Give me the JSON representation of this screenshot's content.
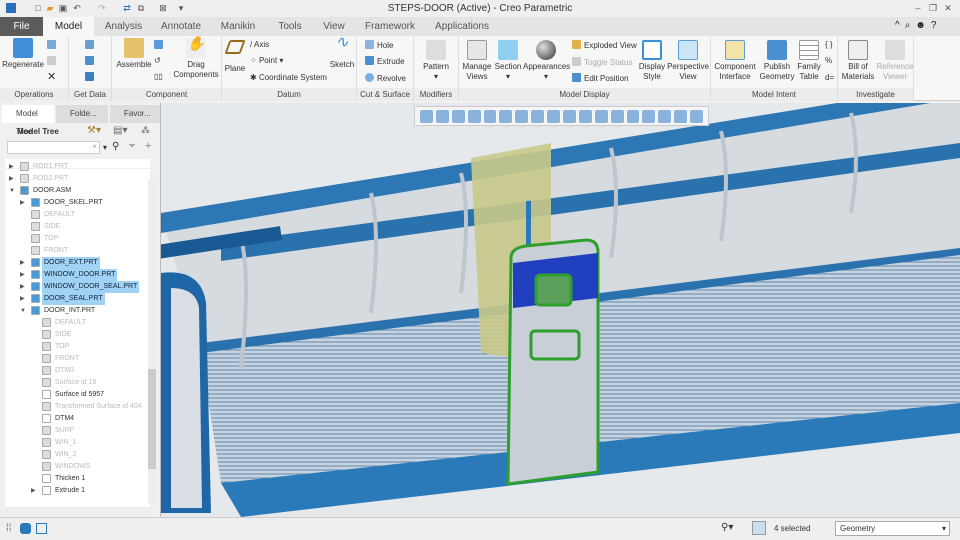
{
  "window": {
    "title": "STEPS-DOOR (Active) - Creo Parametric"
  },
  "tabs": [
    "File",
    "Model",
    "Analysis",
    "Annotate",
    "Manikin",
    "Tools",
    "View",
    "Framework",
    "Applications"
  ],
  "ribbon": {
    "operations": {
      "label": "Operations",
      "regenerate": "Regenerate"
    },
    "get_data": {
      "label": "Get Data"
    },
    "component": {
      "label": "Component",
      "assemble": "Assemble",
      "drag": "Drag Components"
    },
    "datum": {
      "label": "Datum",
      "plane": "Plane",
      "axis": "Axis",
      "point": "Point",
      "csys": "Coordinate System",
      "sketch": "Sketch"
    },
    "cut_surface": {
      "label": "Cut & Surface",
      "hole": "Hole",
      "extrude": "Extrude",
      "revolve": "Revolve"
    },
    "modifiers": {
      "label": "Modifiers",
      "pattern": "Pattern"
    },
    "model_display": {
      "label": "Model Display",
      "manage_views": "Manage Views",
      "section": "Section",
      "appearances": "Appearances",
      "exploded": "Exploded View",
      "toggle": "Toggle Status",
      "edit_position": "Edit Position",
      "display_style": "Display Style",
      "perspective": "Perspective View"
    },
    "model_intent": {
      "label": "Model Intent",
      "component_interface": "Component Interface",
      "publish": "Publish Geometry",
      "family": "Family Table"
    },
    "investigate": {
      "label": "Investigate",
      "bom": "Bill of Materials",
      "reference_viewer": "Reference Viewer"
    }
  },
  "panel": {
    "tabs": [
      "Model Tree",
      "Folde...",
      "Favor..."
    ],
    "title": "Model Tree"
  },
  "tree": [
    {
      "label": "ROD1.PRT",
      "state": "dim",
      "depth": 0,
      "tw": "▶"
    },
    {
      "label": "ROD2.PRT",
      "state": "dim",
      "depth": 0,
      "tw": "▶"
    },
    {
      "label": "DOOR.ASM",
      "state": "normal",
      "depth": 0,
      "tw": "▼"
    },
    {
      "label": "DOOR_SKEL.PRT",
      "state": "normal",
      "depth": 1,
      "tw": "▶"
    },
    {
      "label": "DEFAULT",
      "state": "dim",
      "depth": 1,
      "tw": ""
    },
    {
      "label": "SIDE",
      "state": "dim",
      "depth": 1,
      "tw": ""
    },
    {
      "label": "TOP",
      "state": "dim",
      "depth": 1,
      "tw": ""
    },
    {
      "label": "FRONT",
      "state": "dim",
      "depth": 1,
      "tw": ""
    },
    {
      "label": "DOOR_EXT.PRT",
      "state": "selected",
      "depth": 1,
      "tw": "▶"
    },
    {
      "label": "WINDOW_DOOR.PRT",
      "state": "selected",
      "depth": 1,
      "tw": "▶"
    },
    {
      "label": "WINDOW_DOOR_SEAL.PRT",
      "state": "selected",
      "depth": 1,
      "tw": "▶"
    },
    {
      "label": "DOOR_SEAL.PRT",
      "state": "selected",
      "depth": 1,
      "tw": "▶"
    },
    {
      "label": "DOOR_INT.PRT",
      "state": "normal",
      "depth": 1,
      "tw": "▼"
    },
    {
      "label": "DEFAULT",
      "state": "dim",
      "depth": 2,
      "tw": ""
    },
    {
      "label": "SIDE",
      "state": "dim",
      "depth": 2,
      "tw": ""
    },
    {
      "label": "TOP",
      "state": "dim",
      "depth": 2,
      "tw": ""
    },
    {
      "label": "FRONT",
      "state": "dim",
      "depth": 2,
      "tw": ""
    },
    {
      "label": "DTM3",
      "state": "dim",
      "depth": 2,
      "tw": ""
    },
    {
      "label": "Surface id 19",
      "state": "dim",
      "depth": 2,
      "tw": ""
    },
    {
      "label": "Surface id 5957",
      "state": "normal",
      "depth": 2,
      "tw": ""
    },
    {
      "label": "Transformed Surface id 404",
      "state": "dim",
      "depth": 2,
      "tw": ""
    },
    {
      "label": "DTM4",
      "state": "normal",
      "depth": 2,
      "tw": ""
    },
    {
      "label": "SURF",
      "state": "dim",
      "depth": 2,
      "tw": ""
    },
    {
      "label": "WIN_1",
      "state": "dim",
      "depth": 2,
      "tw": ""
    },
    {
      "label": "WIN_2",
      "state": "dim",
      "depth": 2,
      "tw": ""
    },
    {
      "label": "WINDOWS",
      "state": "dim",
      "depth": 2,
      "tw": ""
    },
    {
      "label": "Thicken 1",
      "state": "normal",
      "depth": 2,
      "tw": ""
    },
    {
      "label": "Extrude 1",
      "state": "normal",
      "depth": 2,
      "tw": "▶"
    }
  ],
  "status": {
    "selected": "4 selected",
    "filter": "Geometry"
  },
  "colors": {
    "accent": "#1a6fb5",
    "selection": "#9fd2f5",
    "door_green": "#2e9e2e",
    "door_blue": "#1f3fbf"
  }
}
